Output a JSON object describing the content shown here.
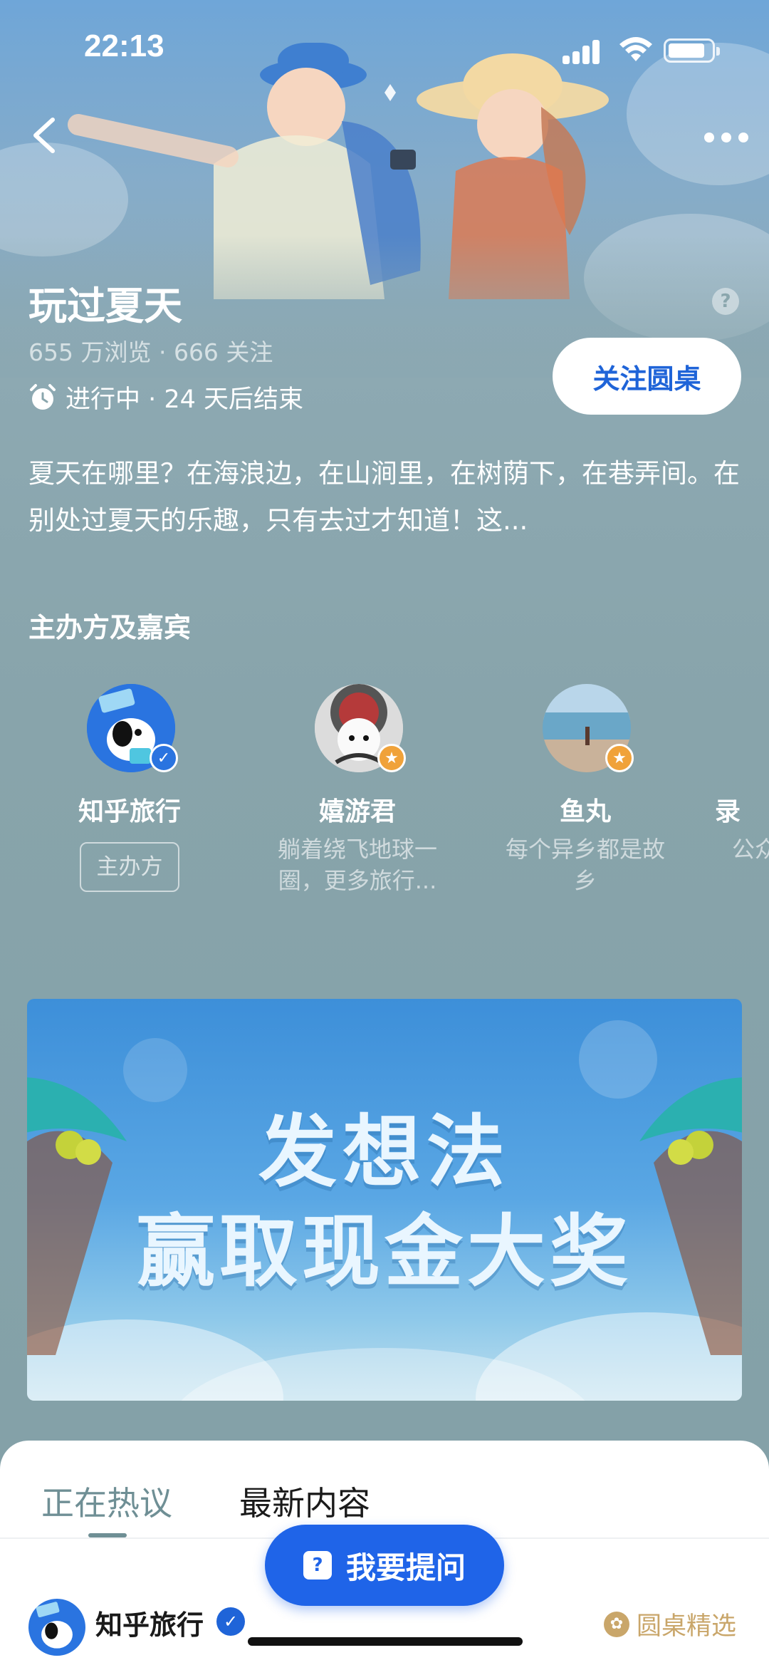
{
  "status_bar": {
    "time": "22:13"
  },
  "header": {
    "title": "玩过夏天",
    "stats": "655 万浏览 · 666 关注",
    "status": "进行中 · 24 天后结束",
    "follow_label": "关注圆桌",
    "help_icon": "?"
  },
  "description": "夏天在哪里？在海浪边，在山涧里，在树荫下，在巷弄间。在别处过夏天的乐趣，只有去过才知道！这...",
  "guests_section": {
    "title": "主办方及嘉宾",
    "guests": [
      {
        "name": "知乎旅行",
        "tag": "主办方",
        "badge": "verified-icon"
      },
      {
        "name": "嬉游君",
        "desc": "躺着绕飞地球一圈，更多旅行...",
        "badge": "star-icon"
      },
      {
        "name": "鱼丸",
        "desc": "每个异乡都是故乡",
        "badge": "star-icon"
      },
      {
        "name": "录",
        "desc": "公众里"
      }
    ]
  },
  "banner": {
    "line1": "发想法",
    "line2": "赢取现金大奖"
  },
  "tabs": {
    "hot": "正在热议",
    "latest": "最新内容"
  },
  "feed": {
    "author": "知乎旅行",
    "tag": "圆桌精选"
  },
  "ask_button": {
    "label": "我要提问",
    "icon": "?"
  },
  "colors": {
    "accent": "#1f64e8",
    "gold": "#c9a66a",
    "page_bg": "#88a4ab"
  }
}
